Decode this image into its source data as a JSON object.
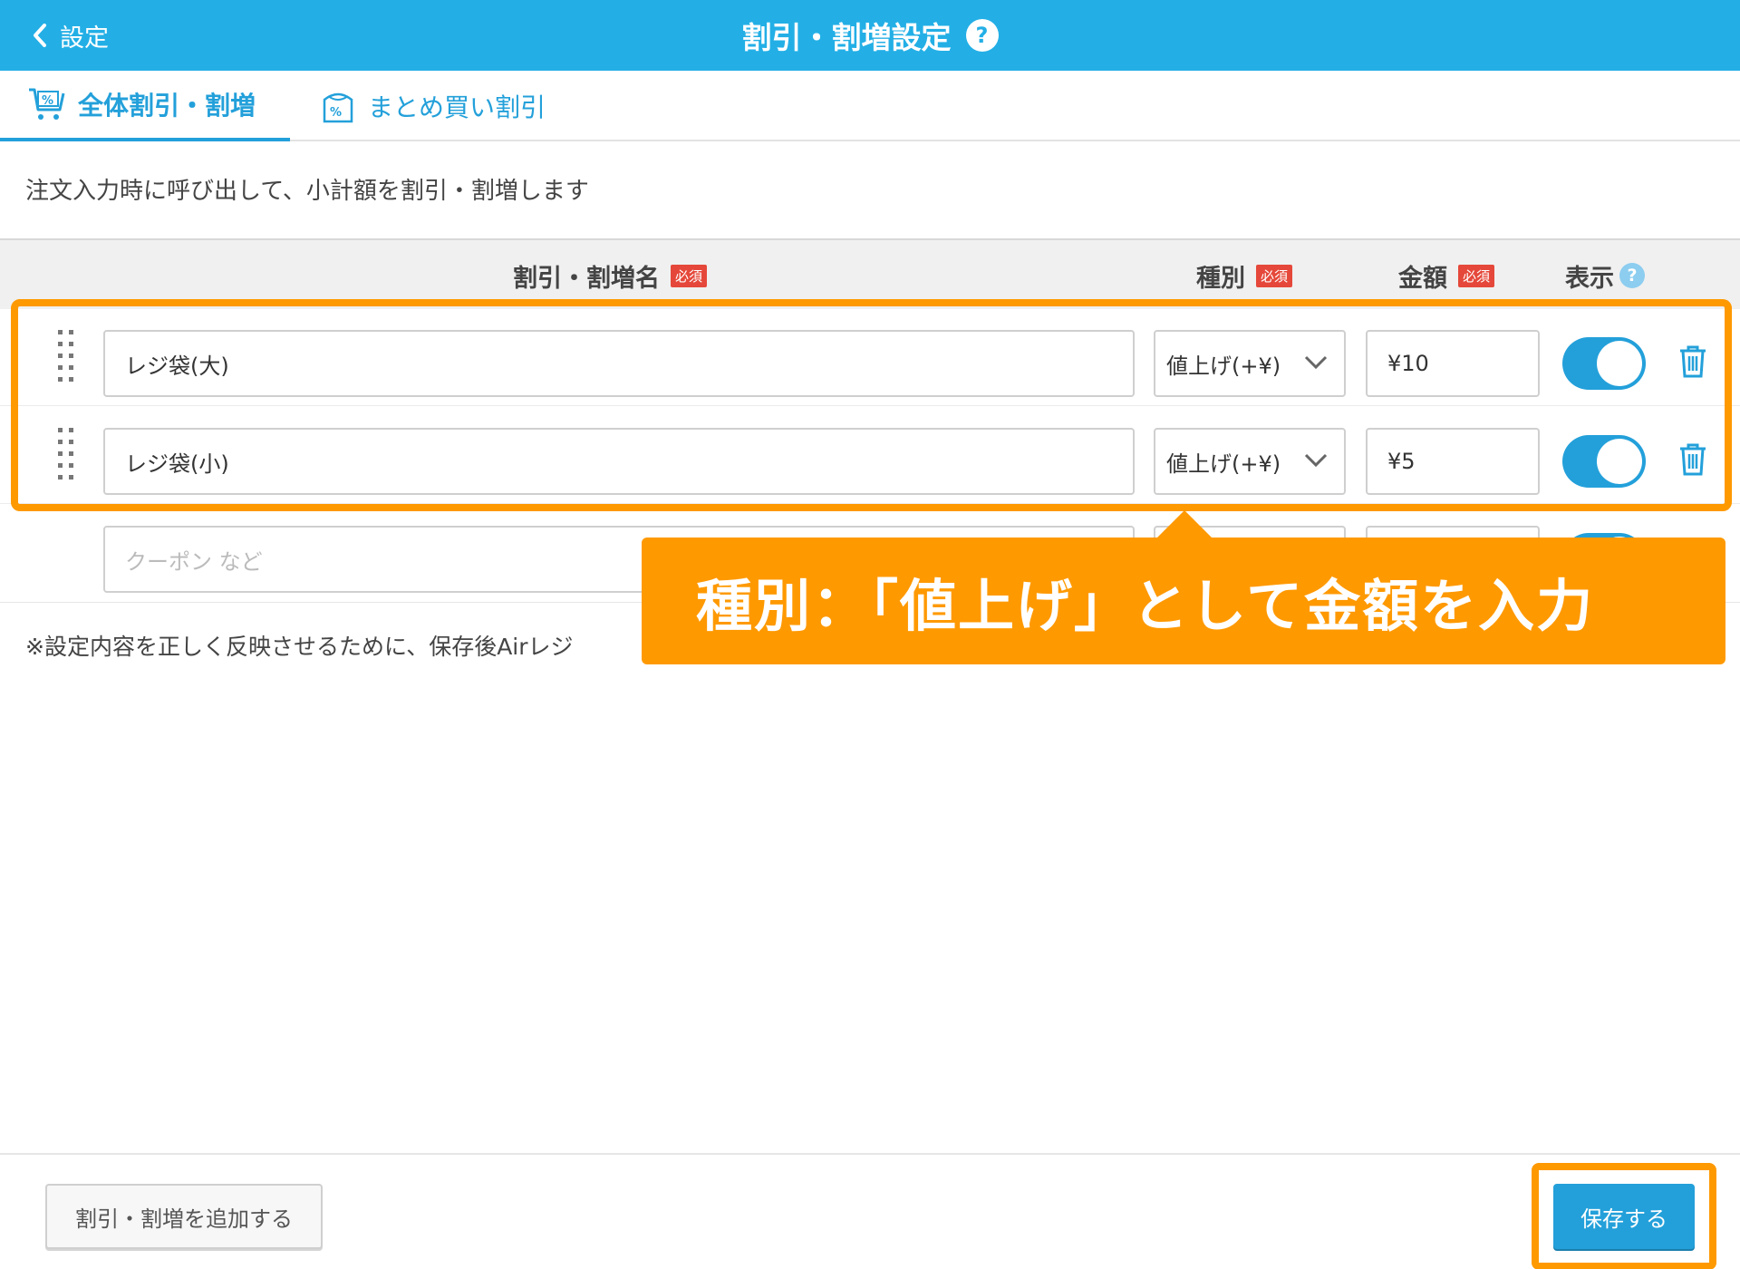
{
  "header": {
    "back_label": "設定",
    "title": "割引・割増設定",
    "help_mark": "?"
  },
  "tabs": [
    {
      "label": "全体割引・割増",
      "active": true
    },
    {
      "label": "まとめ買い割引",
      "active": false
    }
  ],
  "description": "注文入力時に呼び出して、小計額を割引・割増します",
  "table": {
    "columns": {
      "name": "割引・割増名",
      "type": "種別",
      "amount": "金額",
      "display": "表示"
    },
    "required_badge": "必須",
    "help_mark": "?",
    "rows": [
      {
        "name": "レジ袋(大)",
        "type": "値上げ(+¥)",
        "amount": "¥10",
        "display": true
      },
      {
        "name": "レジ袋(小)",
        "type": "値上げ(+¥)",
        "amount": "¥5",
        "display": true
      }
    ],
    "new_row_placeholder": "クーポン など"
  },
  "note": "※設定内容を正しく反映させるために、保存後Airレジ",
  "annotation": {
    "callout_text": "種別：「値上げ」として金額を入力",
    "color": "#ff9900"
  },
  "footer": {
    "add_button": "割引・割増を追加する",
    "save_button": "保存する"
  },
  "colors": {
    "header": "#23afe6",
    "accent": "#23a0da",
    "required": "#e5483a"
  }
}
